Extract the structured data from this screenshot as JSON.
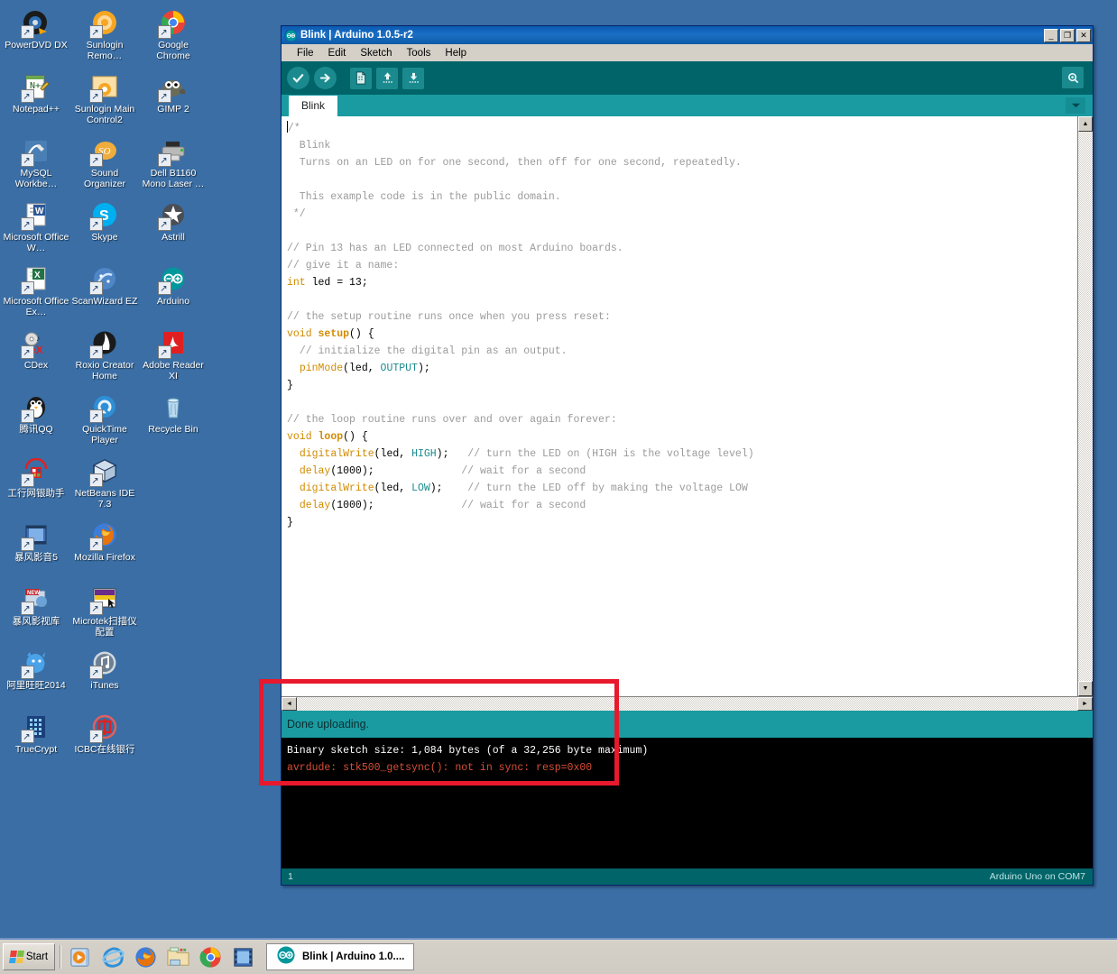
{
  "desktop": {
    "icons": [
      {
        "label": "PowerDVD DX",
        "icon": "powerdvd-icon"
      },
      {
        "label": "Sunlogin Remo…",
        "icon": "sunlogin-remote-icon"
      },
      {
        "label": "Google Chrome",
        "icon": "chrome-icon"
      },
      {
        "label": "Notepad++",
        "icon": "notepadpp-icon"
      },
      {
        "label": "Sunlogin Main Control2",
        "icon": "sunlogin-main-icon"
      },
      {
        "label": "GIMP 2",
        "icon": "gimp-icon"
      },
      {
        "label": "MySQL Workbe…",
        "icon": "mysql-workbench-icon"
      },
      {
        "label": "Sound Organizer",
        "icon": "sound-organizer-icon"
      },
      {
        "label": "Dell B1160 Mono Laser …",
        "icon": "printer-icon"
      },
      {
        "label": "Microsoft Office W…",
        "icon": "word-icon"
      },
      {
        "label": "Skype",
        "icon": "skype-icon"
      },
      {
        "label": "Astrill",
        "icon": "astrill-icon"
      },
      {
        "label": "Microsoft Office Ex…",
        "icon": "excel-icon"
      },
      {
        "label": "ScanWizard EZ",
        "icon": "scanwizard-icon"
      },
      {
        "label": "Arduino",
        "icon": "arduino-icon"
      },
      {
        "label": "CDex",
        "icon": "cdex-icon"
      },
      {
        "label": "Roxio Creator Home",
        "icon": "roxio-icon"
      },
      {
        "label": "Adobe Reader XI",
        "icon": "adobe-reader-icon"
      },
      {
        "label": "腾讯QQ",
        "icon": "qq-icon"
      },
      {
        "label": "QuickTime Player",
        "icon": "quicktime-icon"
      },
      {
        "label": "Recycle Bin",
        "icon": "recycle-bin-icon"
      },
      {
        "label": "工行网银助手",
        "icon": "icbc-helper-icon"
      },
      {
        "label": "NetBeans IDE 7.3",
        "icon": "netbeans-icon"
      },
      {
        "label": "",
        "icon": "empty-icon"
      },
      {
        "label": "暴风影音5",
        "icon": "baofeng-player-icon"
      },
      {
        "label": "Mozilla Firefox",
        "icon": "firefox-icon"
      },
      {
        "label": "",
        "icon": "empty-icon"
      },
      {
        "label": "暴风影视库",
        "icon": "baofeng-library-icon"
      },
      {
        "label": "Microtek扫描仪配置",
        "icon": "microtek-scanner-icon"
      },
      {
        "label": "",
        "icon": "empty-icon"
      },
      {
        "label": "阿里旺旺2014",
        "icon": "aliwangwang-icon"
      },
      {
        "label": "iTunes",
        "icon": "itunes-icon"
      },
      {
        "label": "",
        "icon": "empty-icon"
      },
      {
        "label": "TrueCrypt",
        "icon": "truecrypt-icon"
      },
      {
        "label": "ICBC在线银行",
        "icon": "icbc-bank-icon"
      },
      {
        "label": "",
        "icon": "empty-icon"
      }
    ]
  },
  "window": {
    "title": "Blink | Arduino 1.0.5-r2",
    "controls": {
      "minimize": "_",
      "maximize": "❐",
      "close": "✕"
    },
    "menu": [
      "File",
      "Edit",
      "Sketch",
      "Tools",
      "Help"
    ],
    "toolbar": {
      "verify": "Verify",
      "upload": "Upload",
      "new": "New",
      "open": "Open",
      "save": "Save",
      "serial_monitor": "Serial Monitor"
    },
    "tabs": [
      {
        "label": "Blink",
        "active": true
      }
    ],
    "editor": {
      "lines": [
        [
          {
            "t": "/*",
            "c": "cm"
          }
        ],
        [
          {
            "t": "  Blink",
            "c": "cm"
          }
        ],
        [
          {
            "t": "  Turns on an LED on for one second, then off for one second, repeatedly.",
            "c": "cm"
          }
        ],
        [
          {
            "t": " ",
            "c": "cm"
          }
        ],
        [
          {
            "t": "  This example code is in the public domain.",
            "c": "cm"
          }
        ],
        [
          {
            "t": " */",
            "c": "cm"
          }
        ],
        [
          {
            "t": "",
            "c": "pl"
          }
        ],
        [
          {
            "t": "// Pin 13 has an LED connected on most Arduino boards.",
            "c": "cm"
          }
        ],
        [
          {
            "t": "// give it a name:",
            "c": "cm"
          }
        ],
        [
          {
            "t": "int",
            "c": "kw"
          },
          {
            "t": " led = 13;",
            "c": "pl"
          }
        ],
        [
          {
            "t": "",
            "c": "pl"
          }
        ],
        [
          {
            "t": "// the setup routine runs once when you press reset:",
            "c": "cm"
          }
        ],
        [
          {
            "t": "void",
            "c": "kw"
          },
          {
            "t": " ",
            "c": "pl"
          },
          {
            "t": "setup",
            "c": "fn"
          },
          {
            "t": "() {",
            "c": "pl"
          }
        ],
        [
          {
            "t": "  ",
            "c": "pl"
          },
          {
            "t": "// initialize the digital pin as an output.",
            "c": "cm"
          }
        ],
        [
          {
            "t": "  ",
            "c": "pl"
          },
          {
            "t": "pinMode",
            "c": "kw"
          },
          {
            "t": "(led, ",
            "c": "pl"
          },
          {
            "t": "OUTPUT",
            "c": "cn"
          },
          {
            "t": ");",
            "c": "pl"
          }
        ],
        [
          {
            "t": "}",
            "c": "pl"
          }
        ],
        [
          {
            "t": "",
            "c": "pl"
          }
        ],
        [
          {
            "t": "// the loop routine runs over and over again forever:",
            "c": "cm"
          }
        ],
        [
          {
            "t": "void",
            "c": "kw"
          },
          {
            "t": " ",
            "c": "pl"
          },
          {
            "t": "loop",
            "c": "fn"
          },
          {
            "t": "() {",
            "c": "pl"
          }
        ],
        [
          {
            "t": "  ",
            "c": "pl"
          },
          {
            "t": "digitalWrite",
            "c": "kw"
          },
          {
            "t": "(led, ",
            "c": "pl"
          },
          {
            "t": "HIGH",
            "c": "cn"
          },
          {
            "t": ");   ",
            "c": "pl"
          },
          {
            "t": "// turn the LED on (HIGH is the voltage level)",
            "c": "cm"
          }
        ],
        [
          {
            "t": "  ",
            "c": "pl"
          },
          {
            "t": "delay",
            "c": "kw"
          },
          {
            "t": "(1000);              ",
            "c": "pl"
          },
          {
            "t": "// wait for a second",
            "c": "cm"
          }
        ],
        [
          {
            "t": "  ",
            "c": "pl"
          },
          {
            "t": "digitalWrite",
            "c": "kw"
          },
          {
            "t": "(led, ",
            "c": "pl"
          },
          {
            "t": "LOW",
            "c": "cn"
          },
          {
            "t": ");    ",
            "c": "pl"
          },
          {
            "t": "// turn the LED off by making the voltage LOW",
            "c": "cm"
          }
        ],
        [
          {
            "t": "  ",
            "c": "pl"
          },
          {
            "t": "delay",
            "c": "kw"
          },
          {
            "t": "(1000);              ",
            "c": "pl"
          },
          {
            "t": "// wait for a second",
            "c": "cm"
          }
        ],
        [
          {
            "t": "}",
            "c": "pl"
          }
        ]
      ]
    },
    "status_message": "Done uploading.",
    "console": [
      {
        "text": "Binary sketch size: 1,084 bytes (of a 32,256 byte maximum)",
        "type": "ok"
      },
      {
        "text": "avrdude: stk500_getsync(): not in sync: resp=0x00",
        "type": "err"
      }
    ],
    "bottom_bar": {
      "line_number": "1",
      "board_info": "Arduino Uno on COM7"
    }
  },
  "annotation": {
    "color": "#e8192c"
  },
  "taskbar": {
    "start_label": "Start",
    "quick_launch": [
      {
        "name": "windows-media-player-icon"
      },
      {
        "name": "internet-explorer-icon"
      },
      {
        "name": "firefox-icon"
      },
      {
        "name": "file-explorer-icon"
      },
      {
        "name": "chrome-icon"
      },
      {
        "name": "media-library-icon"
      }
    ],
    "task_button": {
      "label": "Blink | Arduino 1.0....",
      "icon": "arduino-icon"
    }
  }
}
